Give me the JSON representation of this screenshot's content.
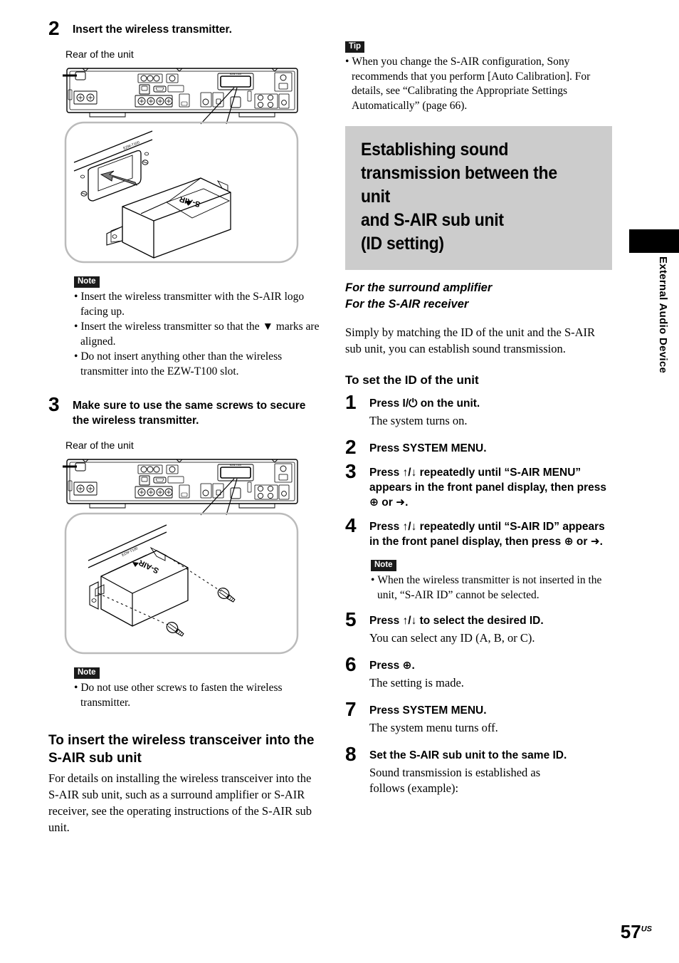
{
  "left": {
    "step2": {
      "num": "2",
      "title": "Insert the wireless transmitter.",
      "caption": "Rear of the unit"
    },
    "note1": {
      "tag": "Note",
      "items": [
        "Insert the wireless transmitter with the S-AIR logo facing up.",
        "Insert the wireless transmitter so that the ▼ marks are aligned.",
        "Do not insert anything other than the wireless transmitter into the EZW-T100 slot."
      ]
    },
    "step3": {
      "num": "3",
      "title": "Make sure to use the same screws to secure the wireless transmitter.",
      "caption": "Rear of the unit"
    },
    "note2": {
      "tag": "Note",
      "items": [
        "Do not use other screws to fasten the wireless transmitter."
      ]
    },
    "section": {
      "heading": "To insert the wireless transceiver into the S-AIR sub unit",
      "body": "For details on installing the wireless transceiver into the S-AIR sub unit, such as a surround amplifier or S-AIR receiver, see the operating instructions of the S-AIR sub unit."
    },
    "figure_labels": {
      "module_logo": "S-AIR",
      "slot_label": "EZW-T100"
    }
  },
  "right": {
    "tip": {
      "tag": "Tip",
      "items": [
        "When you change the S-AIR configuration, Sony recommends that you perform [Auto Calibration]. For details, see “Calibrating the Appropriate Settings Automatically” (page 66)."
      ]
    },
    "chapter_heading": {
      "line1": "Establishing sound",
      "line2": "transmission between the unit",
      "line3": "and S-AIR sub unit",
      "line4": "(ID setting)",
      "background": "#cccccc"
    },
    "italic_sub1": "For the surround amplifier",
    "italic_sub2": "For the S-AIR receiver",
    "intro": "Simply by matching the ID of the unit and the S-AIR sub unit, you can establish sound transmission.",
    "procedure_heading": "To set the ID of the unit",
    "steps": [
      {
        "num": "1",
        "title": "Press I/⏻ on the unit.",
        "body": "The system turns on."
      },
      {
        "num": "2",
        "title": "Press SYSTEM MENU.",
        "body": ""
      },
      {
        "num": "3",
        "title": "Press ↑/↓ repeatedly until “S-AIR MENU” appears in the front panel display, then press ⊕ or ➜.",
        "body": ""
      },
      {
        "num": "4",
        "title": "Press ↑/↓ repeatedly until “S-AIR ID” appears in the front panel display, then press ⊕ or ➜.",
        "body": ""
      },
      {
        "num": "5",
        "title": "Press ↑/↓ to select the desired ID.",
        "body": "You can select any ID (A, B, or C)."
      },
      {
        "num": "6",
        "title": "Press ⊕.",
        "body": "The setting is made."
      },
      {
        "num": "7",
        "title": "Press SYSTEM MENU.",
        "body": "The system menu turns off."
      },
      {
        "num": "8",
        "title": "Set the S-AIR sub unit to the same ID.",
        "body": "Sound transmission is established as follows (example):"
      }
    ],
    "note3": {
      "tag": "Note",
      "items": [
        "When the wireless transmitter is not inserted in the unit, “S-AIR ID” cannot be selected."
      ]
    }
  },
  "sidebar": {
    "label": "External Audio Device"
  },
  "footer": {
    "page_number": "57",
    "page_suffix": "US"
  }
}
